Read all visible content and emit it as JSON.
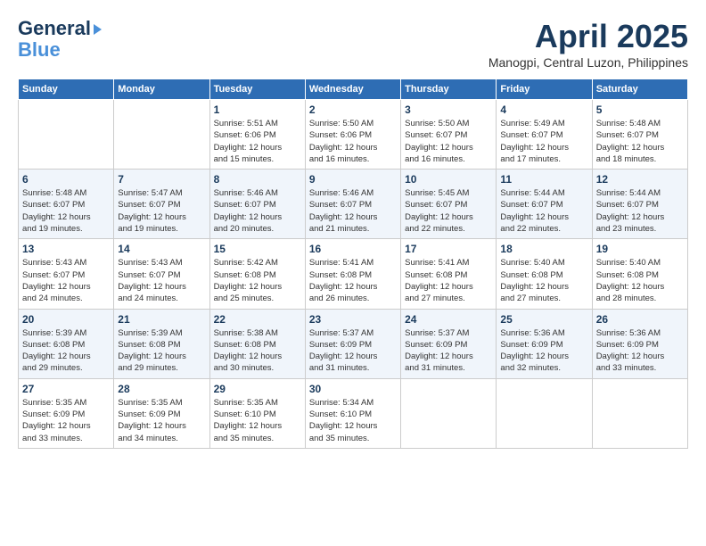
{
  "header": {
    "logo_line1": "General",
    "logo_line2": "Blue",
    "month": "April 2025",
    "location": "Manogpi, Central Luzon, Philippines"
  },
  "weekdays": [
    "Sunday",
    "Monday",
    "Tuesday",
    "Wednesday",
    "Thursday",
    "Friday",
    "Saturday"
  ],
  "weeks": [
    [
      {
        "day": "",
        "info": ""
      },
      {
        "day": "",
        "info": ""
      },
      {
        "day": "1",
        "info": "Sunrise: 5:51 AM\nSunset: 6:06 PM\nDaylight: 12 hours\nand 15 minutes."
      },
      {
        "day": "2",
        "info": "Sunrise: 5:50 AM\nSunset: 6:06 PM\nDaylight: 12 hours\nand 16 minutes."
      },
      {
        "day": "3",
        "info": "Sunrise: 5:50 AM\nSunset: 6:07 PM\nDaylight: 12 hours\nand 16 minutes."
      },
      {
        "day": "4",
        "info": "Sunrise: 5:49 AM\nSunset: 6:07 PM\nDaylight: 12 hours\nand 17 minutes."
      },
      {
        "day": "5",
        "info": "Sunrise: 5:48 AM\nSunset: 6:07 PM\nDaylight: 12 hours\nand 18 minutes."
      }
    ],
    [
      {
        "day": "6",
        "info": "Sunrise: 5:48 AM\nSunset: 6:07 PM\nDaylight: 12 hours\nand 19 minutes."
      },
      {
        "day": "7",
        "info": "Sunrise: 5:47 AM\nSunset: 6:07 PM\nDaylight: 12 hours\nand 19 minutes."
      },
      {
        "day": "8",
        "info": "Sunrise: 5:46 AM\nSunset: 6:07 PM\nDaylight: 12 hours\nand 20 minutes."
      },
      {
        "day": "9",
        "info": "Sunrise: 5:46 AM\nSunset: 6:07 PM\nDaylight: 12 hours\nand 21 minutes."
      },
      {
        "day": "10",
        "info": "Sunrise: 5:45 AM\nSunset: 6:07 PM\nDaylight: 12 hours\nand 22 minutes."
      },
      {
        "day": "11",
        "info": "Sunrise: 5:44 AM\nSunset: 6:07 PM\nDaylight: 12 hours\nand 22 minutes."
      },
      {
        "day": "12",
        "info": "Sunrise: 5:44 AM\nSunset: 6:07 PM\nDaylight: 12 hours\nand 23 minutes."
      }
    ],
    [
      {
        "day": "13",
        "info": "Sunrise: 5:43 AM\nSunset: 6:07 PM\nDaylight: 12 hours\nand 24 minutes."
      },
      {
        "day": "14",
        "info": "Sunrise: 5:43 AM\nSunset: 6:07 PM\nDaylight: 12 hours\nand 24 minutes."
      },
      {
        "day": "15",
        "info": "Sunrise: 5:42 AM\nSunset: 6:08 PM\nDaylight: 12 hours\nand 25 minutes."
      },
      {
        "day": "16",
        "info": "Sunrise: 5:41 AM\nSunset: 6:08 PM\nDaylight: 12 hours\nand 26 minutes."
      },
      {
        "day": "17",
        "info": "Sunrise: 5:41 AM\nSunset: 6:08 PM\nDaylight: 12 hours\nand 27 minutes."
      },
      {
        "day": "18",
        "info": "Sunrise: 5:40 AM\nSunset: 6:08 PM\nDaylight: 12 hours\nand 27 minutes."
      },
      {
        "day": "19",
        "info": "Sunrise: 5:40 AM\nSunset: 6:08 PM\nDaylight: 12 hours\nand 28 minutes."
      }
    ],
    [
      {
        "day": "20",
        "info": "Sunrise: 5:39 AM\nSunset: 6:08 PM\nDaylight: 12 hours\nand 29 minutes."
      },
      {
        "day": "21",
        "info": "Sunrise: 5:39 AM\nSunset: 6:08 PM\nDaylight: 12 hours\nand 29 minutes."
      },
      {
        "day": "22",
        "info": "Sunrise: 5:38 AM\nSunset: 6:08 PM\nDaylight: 12 hours\nand 30 minutes."
      },
      {
        "day": "23",
        "info": "Sunrise: 5:37 AM\nSunset: 6:09 PM\nDaylight: 12 hours\nand 31 minutes."
      },
      {
        "day": "24",
        "info": "Sunrise: 5:37 AM\nSunset: 6:09 PM\nDaylight: 12 hours\nand 31 minutes."
      },
      {
        "day": "25",
        "info": "Sunrise: 5:36 AM\nSunset: 6:09 PM\nDaylight: 12 hours\nand 32 minutes."
      },
      {
        "day": "26",
        "info": "Sunrise: 5:36 AM\nSunset: 6:09 PM\nDaylight: 12 hours\nand 33 minutes."
      }
    ],
    [
      {
        "day": "27",
        "info": "Sunrise: 5:35 AM\nSunset: 6:09 PM\nDaylight: 12 hours\nand 33 minutes."
      },
      {
        "day": "28",
        "info": "Sunrise: 5:35 AM\nSunset: 6:09 PM\nDaylight: 12 hours\nand 34 minutes."
      },
      {
        "day": "29",
        "info": "Sunrise: 5:35 AM\nSunset: 6:10 PM\nDaylight: 12 hours\nand 35 minutes."
      },
      {
        "day": "30",
        "info": "Sunrise: 5:34 AM\nSunset: 6:10 PM\nDaylight: 12 hours\nand 35 minutes."
      },
      {
        "day": "",
        "info": ""
      },
      {
        "day": "",
        "info": ""
      },
      {
        "day": "",
        "info": ""
      }
    ]
  ]
}
